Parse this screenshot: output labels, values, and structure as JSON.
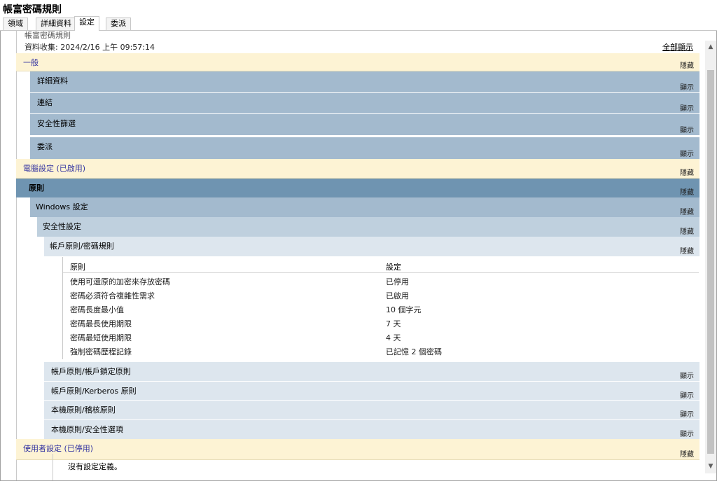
{
  "window": {
    "title": "帳富密碼規則"
  },
  "tabs": [
    {
      "label": "領域"
    },
    {
      "label": "詳細資料"
    },
    {
      "label": "設定"
    },
    {
      "label": "委派"
    }
  ],
  "report": {
    "clipped_title": "帳富密碼規則",
    "data_collected": "資料收集: 2024/2/16 上午 09:57:14",
    "show_all": "全部顯示"
  },
  "sections": {
    "general": {
      "label": "一般",
      "action": "隱藏"
    },
    "details": {
      "label": "詳細資料",
      "action": "顯示"
    },
    "links": {
      "label": "連結",
      "action": "顯示"
    },
    "security_filter": {
      "label": "安全性篩選",
      "action": "顯示"
    },
    "delegation": {
      "label": "委派",
      "action": "顯示"
    },
    "computer": {
      "label": "電腦設定 (已啟用)",
      "action": "隱藏"
    },
    "policies": {
      "label": "原則",
      "action": "隱藏"
    },
    "windows_settings": {
      "label": "Windows 設定",
      "action": "隱藏"
    },
    "security_settings": {
      "label": "安全性設定",
      "action": "隱藏"
    },
    "password_policy": {
      "label": "帳戶原則/密碼規則",
      "action": "隱藏"
    },
    "lockout_policy": {
      "label": "帳戶原則/帳戶鎖定原則",
      "action": "顯示"
    },
    "kerberos_policy": {
      "label": "帳戶原則/Kerberos 原則",
      "action": "顯示"
    },
    "audit_policy": {
      "label": "本機原則/稽核原則",
      "action": "顯示"
    },
    "security_options": {
      "label": "本機原則/安全性選項",
      "action": "顯示"
    },
    "user": {
      "label": "使用者設定 (已停用)",
      "action": "隱藏"
    }
  },
  "policy_table": {
    "headers": {
      "policy": "原則",
      "setting": "設定"
    },
    "rows": [
      {
        "policy": "使用可還原的加密來存放密碼",
        "setting": "已停用"
      },
      {
        "policy": "密碼必須符合複雜性需求",
        "setting": "已啟用"
      },
      {
        "policy": "密碼長度最小值",
        "setting": "10 個字元"
      },
      {
        "policy": "密碼最長使用期限",
        "setting": "7 天"
      },
      {
        "policy": "密碼最短使用期限",
        "setting": "4 天"
      },
      {
        "policy": "強制密碼歷程記錄",
        "setting": "已記憶 2 個密碼"
      }
    ]
  },
  "user_settings": {
    "no_definition": "沒有設定定義。"
  },
  "scrollbar": {
    "up": "▲",
    "down": "▼"
  }
}
